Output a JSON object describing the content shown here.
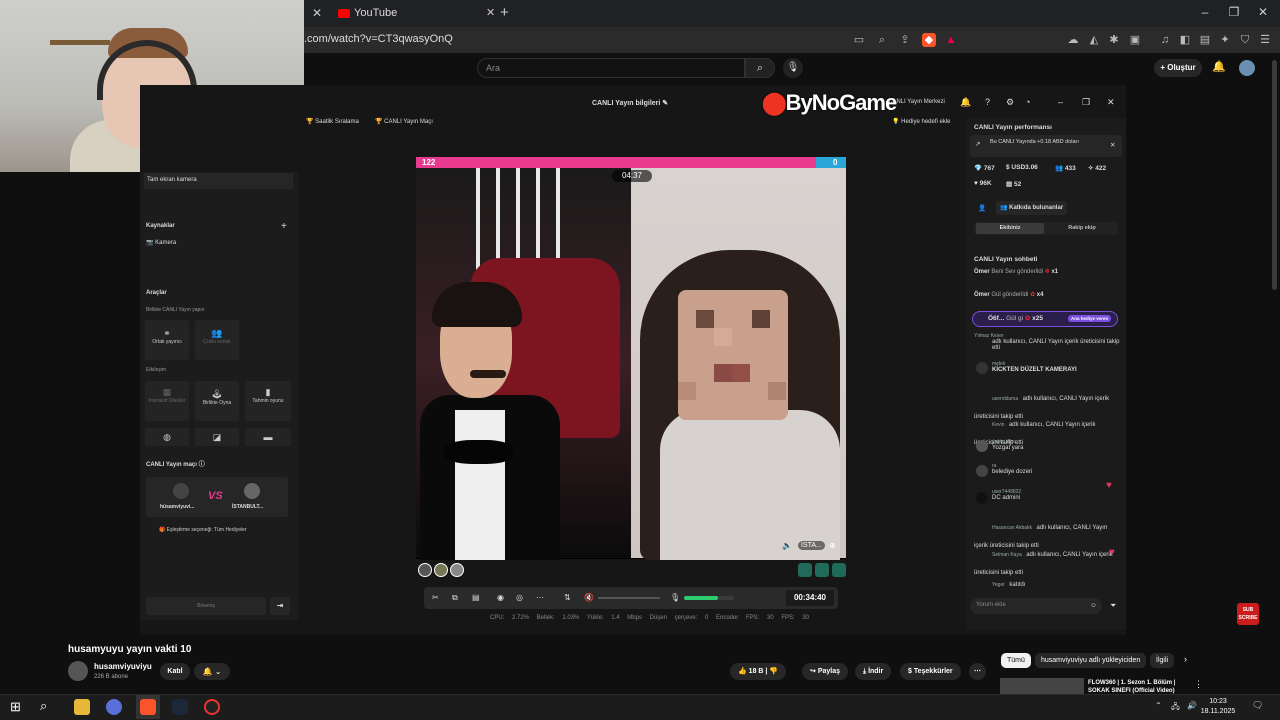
{
  "browser": {
    "tab_title": "YouTube",
    "url": ".com/watch?v=CT3qwasyOnQ"
  },
  "youtube": {
    "search_placeholder": "Ara",
    "create_label": "Oluştur",
    "video_title": "husamyuyu yayın vakti 10",
    "channel_name": "husamviyuviyu",
    "channel_subs": "226 B abone",
    "join_label": "Katıl",
    "like_count": "18 B",
    "share_label": "Paylaş",
    "download_label": "İndir",
    "thanks_label": "Teşekkürler",
    "chips": [
      "Tümü",
      "husamviyuviyu adlı yükleyiciden",
      "İlgili"
    ],
    "rec_title": "FLOW360 | 1. Sezon 1. Bölüm | SOKAK SINEFI (Official Video)",
    "sub_badge": "SUB SCRIBE"
  },
  "studio": {
    "top_left_pill_1": "Saatlik Sıralama",
    "top_left_pill_2": "CANLI Yayın Maçı",
    "center_title": "CANLI Yayın bilgileri",
    "watermark": "ByNoGame",
    "live_center": "CANLI Yayın Merkezi",
    "gift_target": "Hediye hedefi ekle",
    "fullscreen_cam": "Tam ekran kamera",
    "sources_title": "Kaynaklar",
    "camera_label": "Kamera",
    "tools_title": "Araçlar",
    "together_live": "Birlikte CANLI Yayın yapın",
    "co_host": "Ortak yayıncı",
    "multi_guest": "Çoklu konuk",
    "interaction": "Etkileşim",
    "interactive_gifts": "İnteraktif Dilekler",
    "play_together": "Birlikte Oyna",
    "guess_game": "Tahmin oyunu",
    "match_title": "CANLI Yayın maçı",
    "match_left": "hüsamviyuvi...",
    "match_vs": "VS",
    "match_right": "İSTANBULT...",
    "pairing": "Eşleştirme seçeneği: Tüm Hediyeler",
    "bottom_btn": "Böwenş",
    "pk_left_score": "122",
    "pk_right_score": "0",
    "pk_timer": "04:37",
    "right_cam_tag": "İSTA...",
    "elapsed": "00:34:40",
    "stats": "CPU: 2.72%   Bellek: 1.03%   Yükle: 1.4 Mbps   Düşen çerçeve: 0   Encoder FPS: 30   FPS: 30"
  },
  "performance": {
    "title": "CANLI Yayın performansı",
    "earn_notice": "Bu CANLI Yayında +0.18 ABD doları",
    "stat_diamonds": "767",
    "stat_usd": "USD3.06",
    "stat_viewers": "433",
    "stat_likes": "422",
    "stat_views": "96K",
    "stat_gifts": "52",
    "contributors": "Katkıda bulunanlar",
    "tab_team": "Ekibiniz",
    "tab_rival": "Rakip ekip"
  },
  "chat": {
    "title": "CANLI Yayın sohbeti",
    "gift_1_user": "Ömer",
    "gift_1_text": "Beni Sev gönderildi",
    "gift_1_count": "x1",
    "gift_2_user": "Ömer",
    "gift_2_text": "Gül gönderildi",
    "gift_2_count": "x4",
    "gift_3_user": "Ö6f...",
    "gift_3_text": "Gül gi",
    "gift_3_count": "x25",
    "gift_3_badge": "Ana hediye veren",
    "msgs": [
      {
        "user": "Yılmaz Keser",
        "text": "adlı kullanıcı, CANLI Yayın içerik üreticisini takip etti"
      },
      {
        "user": "melek",
        "text": "KİCKTEN DÜZELT KAMERAYI"
      },
      {
        "user": "userolduma",
        "text": "adlı kullanıcı, CANLI Yayın içerik üreticisini takip etti"
      },
      {
        "user": "Kevin",
        "text": "adlı kullanıcı, CANLI Yayın içerik üreticisini takip etti"
      },
      {
        "user": "yagiz_dfgc",
        "text": "Yozgat yara"
      },
      {
        "user": "ra",
        "text": "belediye dozeri"
      },
      {
        "user": "user7448832",
        "text": "DC admini"
      },
      {
        "user": "Hasancan Akbalık",
        "text": "adlı kullanıcı, CANLI Yayın içerik üreticisini takip etti"
      },
      {
        "user": "Selman Kaya",
        "text": "adlı kullanıcı, CANLI Yayın içerik üreticisini takip etti"
      },
      {
        "user": "Yeger",
        "text": "katıldı"
      }
    ],
    "input_placeholder": "Yorum ekle"
  },
  "taskbar": {
    "time": "10:23",
    "date": "18.11.2025"
  },
  "colors": {
    "pk_pink": "#e83a8e",
    "pk_blue": "#2aa7d8",
    "youtube_red": "#ff0000"
  }
}
